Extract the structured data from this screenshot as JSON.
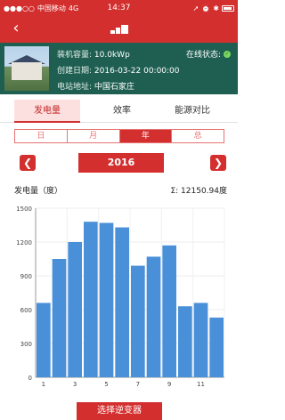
{
  "status_bar": {
    "carrier": "中国移动",
    "network": "4G",
    "time": "14:37"
  },
  "station": {
    "capacity_label": "装机容量:",
    "capacity_value": "10.0kWp",
    "created_label": "创建日期:",
    "created_value": "2016-03-22 00:00:00",
    "address_label": "电站地址:",
    "address_value": "中国石家庄",
    "online_label": "在线状态:"
  },
  "tabs": [
    {
      "label": "发电量",
      "active": true
    },
    {
      "label": "效率",
      "active": false
    },
    {
      "label": "能源对比",
      "active": false
    }
  ],
  "periods": [
    {
      "label": "日",
      "active": false
    },
    {
      "label": "月",
      "active": false
    },
    {
      "label": "年",
      "active": true
    },
    {
      "label": "总",
      "active": false
    }
  ],
  "year_nav": {
    "year": "2016",
    "prev_icon": "chevron-left-icon",
    "next_icon": "chevron-right-icon"
  },
  "chart_header": {
    "title": "发电量（度）",
    "total": "Σ: 12150.94度"
  },
  "chart_data": {
    "type": "bar",
    "categories": [
      "1",
      "2",
      "3",
      "4",
      "5",
      "6",
      "7",
      "8",
      "9",
      "10",
      "11",
      "12"
    ],
    "x_tick_labels": [
      "1",
      "3",
      "5",
      "7",
      "9",
      "11"
    ],
    "values": [
      660,
      1050,
      1200,
      1380,
      1370,
      1330,
      990,
      1070,
      1170,
      630,
      660,
      530
    ],
    "ylim": [
      0,
      1500
    ],
    "yticks": [
      0,
      300,
      600,
      900,
      1200,
      1500
    ],
    "bar_color": "#4a90d9",
    "grid": true
  },
  "select_button": "选择逆变器",
  "colors": {
    "accent": "#d32f2f",
    "station_bg": "#1f5f52"
  }
}
